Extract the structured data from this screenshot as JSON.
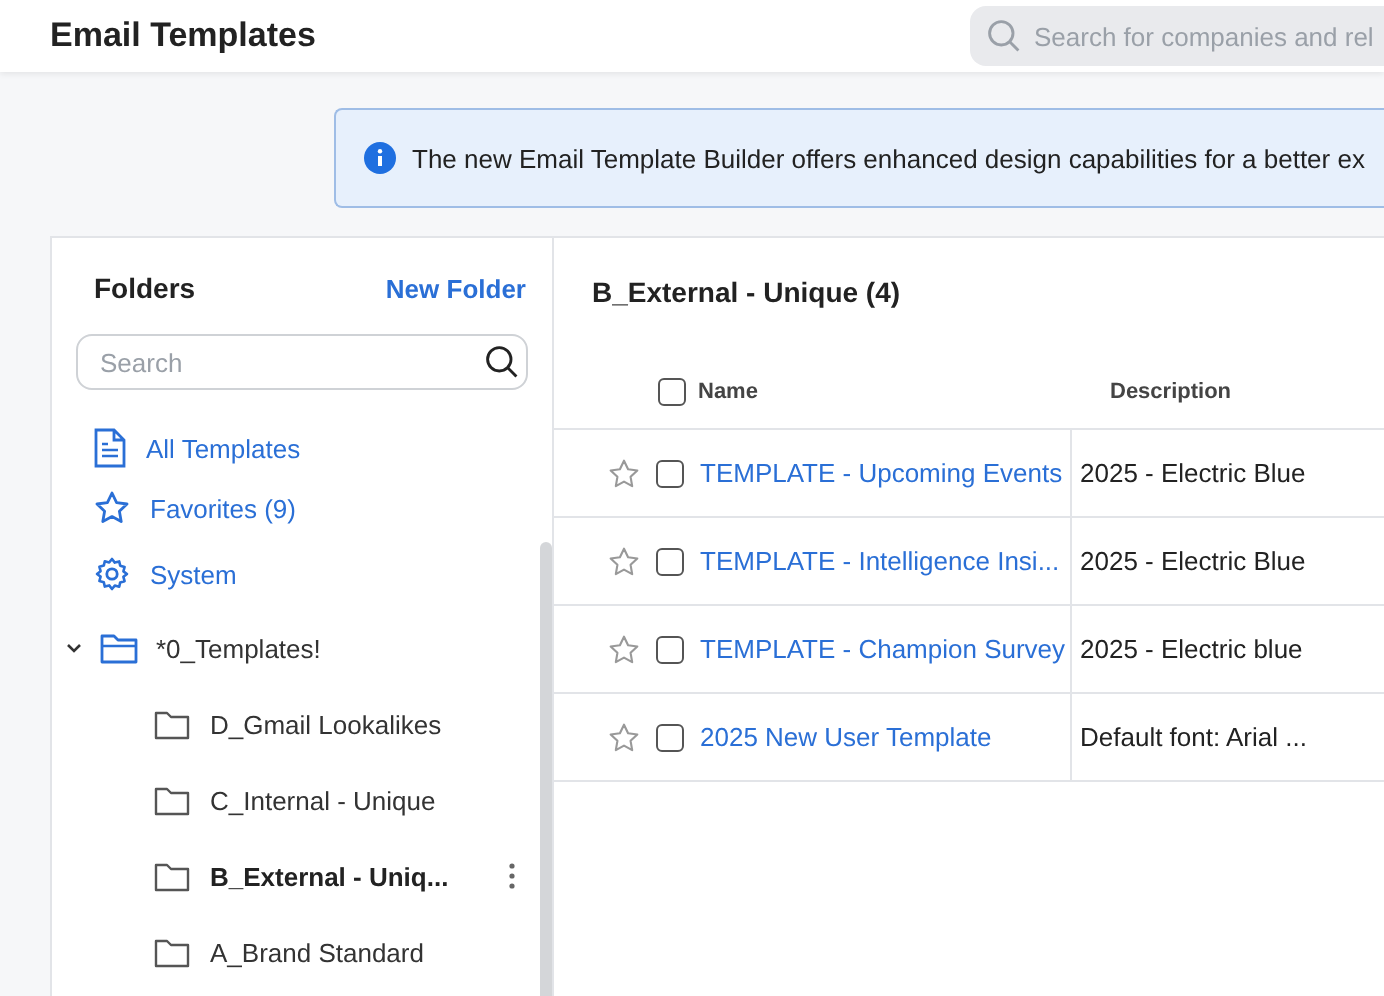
{
  "header": {
    "title": "Email Templates",
    "search": {
      "placeholder": "Search for companies and rel"
    }
  },
  "banner": {
    "text": "The new Email Template Builder offers enhanced design capabilities for a better ex"
  },
  "sidebar": {
    "title": "Folders",
    "new_folder": "New Folder",
    "search": {
      "placeholder": "Search"
    },
    "items": [
      {
        "kind": "document",
        "label": "All Templates"
      },
      {
        "kind": "star",
        "label": "Favorites (9)"
      },
      {
        "kind": "gear",
        "label": "System"
      }
    ],
    "tree": [
      {
        "label": "*0_Templates!",
        "expanded": true,
        "children": [
          {
            "label": "D_Gmail Lookalikes",
            "selected": false
          },
          {
            "label": "C_Internal - Unique",
            "selected": false
          },
          {
            "label": "B_External - Uniq...",
            "selected": true
          },
          {
            "label": "A_Brand Standard",
            "selected": false
          }
        ]
      }
    ]
  },
  "main": {
    "title": "B_External - Unique (4)",
    "table": {
      "select_all_checked": false,
      "columns": [
        "Name",
        "Description"
      ],
      "rows": [
        {
          "favorite": false,
          "checked": false,
          "name": "TEMPLATE - Upcoming Events",
          "description": "2025 - Electric Blue"
        },
        {
          "favorite": false,
          "checked": false,
          "name": "TEMPLATE - Intelligence Insi...",
          "description": "2025 - Electric Blue"
        },
        {
          "favorite": false,
          "checked": false,
          "name": "TEMPLATE - Champion Survey",
          "description": "2025 - Electric blue"
        },
        {
          "favorite": false,
          "checked": false,
          "name": "2025 New User Template",
          "description": "Default font: Arial ..."
        }
      ]
    }
  }
}
